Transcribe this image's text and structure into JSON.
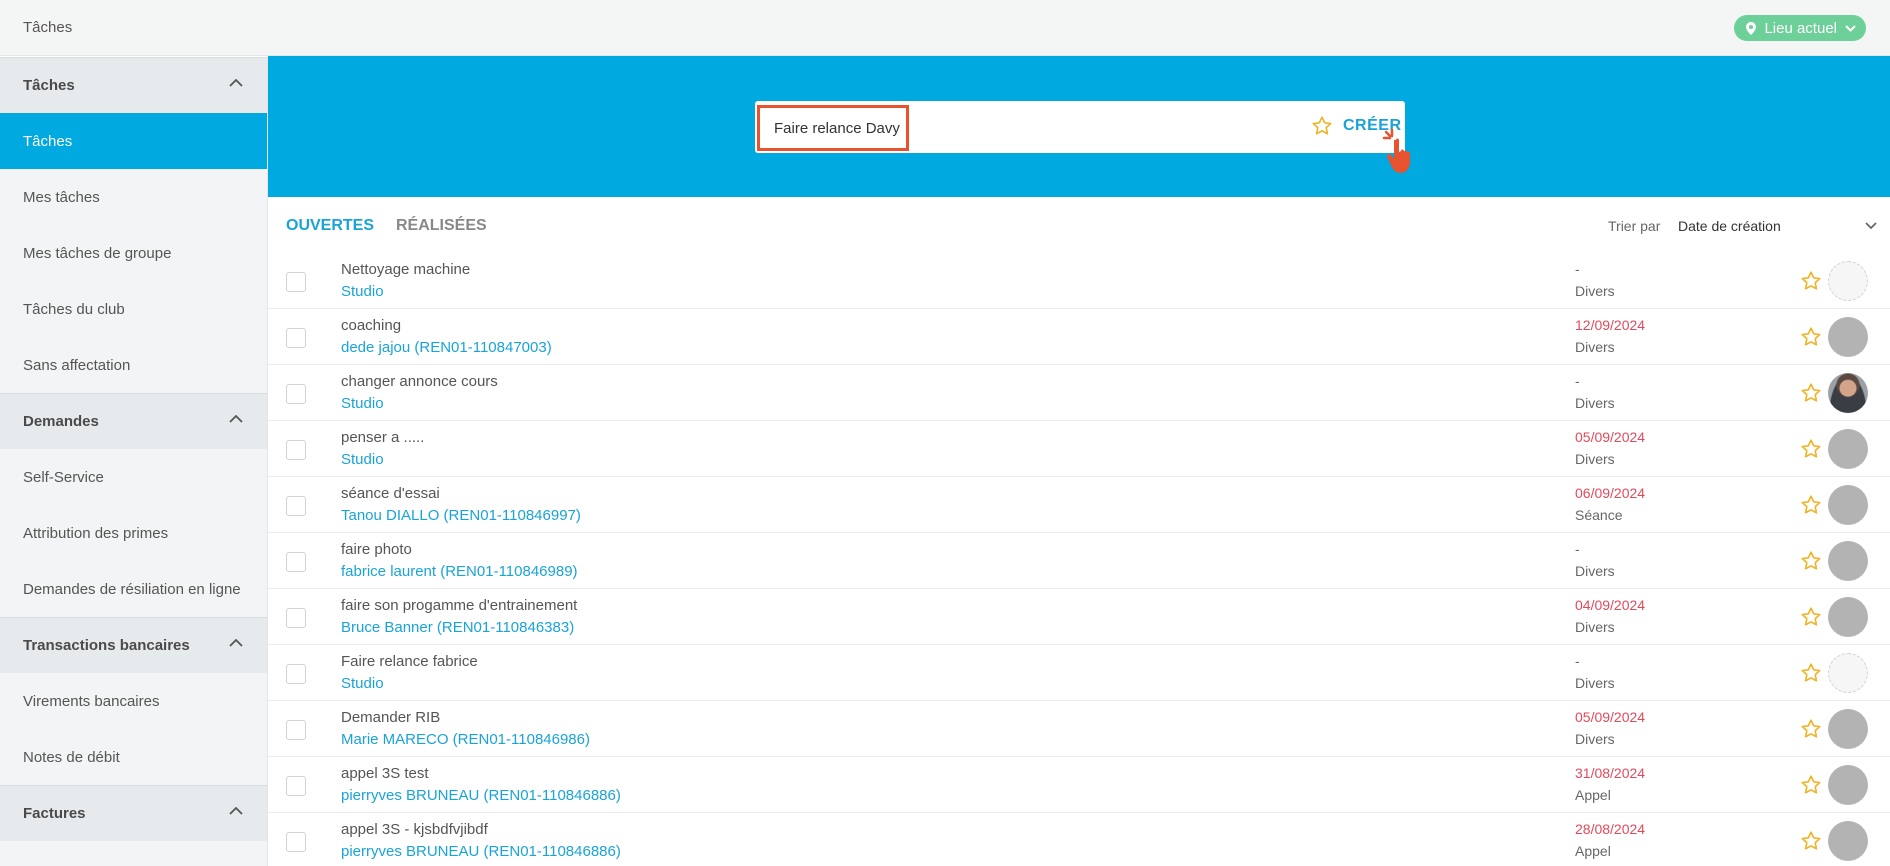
{
  "topbar": {
    "title": "Tâches",
    "location": "Lieu actuel"
  },
  "sidebar": {
    "sections": [
      {
        "label": "Tâches",
        "items": [
          "Tâches",
          "Mes tâches",
          "Mes tâches de groupe",
          "Tâches du club",
          "Sans affectation"
        ]
      },
      {
        "label": "Demandes",
        "items": [
          "Self-Service",
          "Attribution des primes",
          "Demandes de résiliation en ligne"
        ]
      },
      {
        "label": "Transactions bancaires",
        "items": [
          "Virements bancaires",
          "Notes de débit"
        ]
      },
      {
        "label": "Factures",
        "items": []
      }
    ],
    "active_item": "Tâches"
  },
  "create": {
    "value": "Faire relance Davy",
    "button": "CRÉER"
  },
  "tabs": {
    "open": "OUVERTES",
    "done": "RÉALISÉES"
  },
  "sort": {
    "label": "Trier par",
    "value": "Date de création"
  },
  "colors": {
    "accent": "#00a9e0",
    "link": "#1aa3d8",
    "overdue": "#e24a5a",
    "star": "#f0b429",
    "location": "#6cd098",
    "highlight": "#e8532f"
  },
  "tasks": [
    {
      "title": "Nettoyage machine",
      "sub": "Studio",
      "date": "-",
      "overdue": false,
      "type": "Divers",
      "avatar": "empty"
    },
    {
      "title": "coaching",
      "sub": "dede jajou (REN01-110847003)",
      "date": "12/09/2024",
      "overdue": true,
      "type": "Divers",
      "avatar": "grey"
    },
    {
      "title": "changer annonce cours",
      "sub": "Studio",
      "date": "-",
      "overdue": false,
      "type": "Divers",
      "avatar": "photo"
    },
    {
      "title": "penser a .....",
      "sub": "Studio",
      "date": "05/09/2024",
      "overdue": true,
      "type": "Divers",
      "avatar": "grey"
    },
    {
      "title": "séance d'essai",
      "sub": "Tanou DIALLO (REN01-110846997)",
      "date": "06/09/2024",
      "overdue": true,
      "type": "Séance",
      "avatar": "grey"
    },
    {
      "title": "faire photo",
      "sub": "fabrice laurent (REN01-110846989)",
      "date": "-",
      "overdue": false,
      "type": "Divers",
      "avatar": "grey"
    },
    {
      "title": "faire son progamme d'entrainement",
      "sub": "Bruce Banner (REN01-110846383)",
      "date": "04/09/2024",
      "overdue": true,
      "type": "Divers",
      "avatar": "grey"
    },
    {
      "title": "Faire relance fabrice",
      "sub": "Studio",
      "date": "-",
      "overdue": false,
      "type": "Divers",
      "avatar": "empty"
    },
    {
      "title": "Demander RIB",
      "sub": "Marie MARECO (REN01-110846986)",
      "date": "05/09/2024",
      "overdue": true,
      "type": "Divers",
      "avatar": "grey"
    },
    {
      "title": "appel 3S test",
      "sub": "pierryves BRUNEAU (REN01-110846886)",
      "date": "31/08/2024",
      "overdue": true,
      "type": "Appel",
      "avatar": "grey"
    },
    {
      "title": "appel 3S - kjsbdfvjibdf",
      "sub": "pierryves BRUNEAU (REN01-110846886)",
      "date": "28/08/2024",
      "overdue": true,
      "type": "Appel",
      "avatar": "grey"
    }
  ]
}
